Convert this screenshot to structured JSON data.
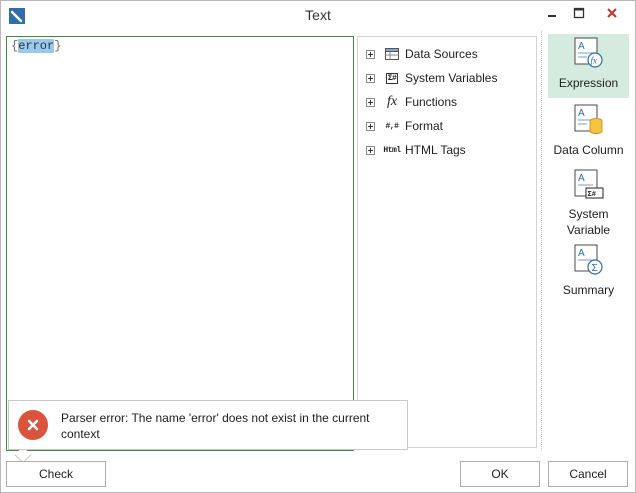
{
  "window": {
    "title": "Text"
  },
  "editor": {
    "brace_open": "{",
    "expression": "error",
    "brace_close": "}"
  },
  "tree": {
    "items": [
      {
        "label": "Data Sources",
        "icon": "table-icon"
      },
      {
        "label": "System Variables",
        "icon": "system-variable-icon",
        "icon_text": "Σ#"
      },
      {
        "label": "Functions",
        "icon": "function-icon",
        "icon_text": "fx"
      },
      {
        "label": "Format",
        "icon": "format-icon",
        "icon_text": "#,#"
      },
      {
        "label": "HTML Tags",
        "icon": "html-icon",
        "icon_text": "Html"
      }
    ]
  },
  "side_panel": {
    "items": [
      {
        "label": "Expression",
        "icon": "expression-icon",
        "active": true
      },
      {
        "label": "Data Column",
        "icon": "data-column-icon",
        "active": false
      },
      {
        "label": "System Variable",
        "label_line1": "System",
        "label_line2": "Variable",
        "icon": "system-variable-icon",
        "active": false
      },
      {
        "label": "Summary",
        "icon": "summary-icon",
        "active": false
      }
    ]
  },
  "error_tooltip": {
    "line1": "Parser error: The name 'error' does not exist in the current",
    "line2": "context"
  },
  "buttons": {
    "check": "Check",
    "ok": "OK",
    "cancel": "Cancel"
  },
  "colors": {
    "accent_green": "#3c8b45",
    "selection": "#99c9ef",
    "error_red": "#d9533d",
    "close_red": "#c9302c",
    "active_side": "#d6ebe0"
  }
}
